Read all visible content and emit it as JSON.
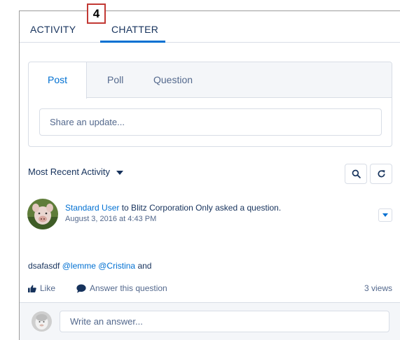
{
  "step_badge": "4",
  "tabs": [
    {
      "label": "ACTIVITY"
    },
    {
      "label": "CHATTER",
      "active": true
    }
  ],
  "publisher": {
    "tabs": [
      {
        "label": "Post",
        "active": true
      },
      {
        "label": "Poll"
      },
      {
        "label": "Question"
      }
    ],
    "placeholder": "Share an update..."
  },
  "feed": {
    "sort_label": "Most Recent Activity",
    "search_icon": "search-icon",
    "refresh_icon": "refresh-icon"
  },
  "post": {
    "author": "Standard User",
    "action_text": "to Blitz Corporation Only asked a question.",
    "date": "August 3, 2016 at 4:43 PM",
    "body_prefix": "dsafasdf",
    "mention_1": "@lemme",
    "mention_2": "@Cristina",
    "body_suffix": "and",
    "like_label": "Like",
    "answer_label": "Answer this question",
    "views": "3 views"
  },
  "answer": {
    "placeholder": "Write an answer..."
  },
  "colors": {
    "accent": "#0070d2",
    "text": "#16325c",
    "muted": "#54698d",
    "border": "#d8dde6",
    "badge": "#c23934"
  }
}
